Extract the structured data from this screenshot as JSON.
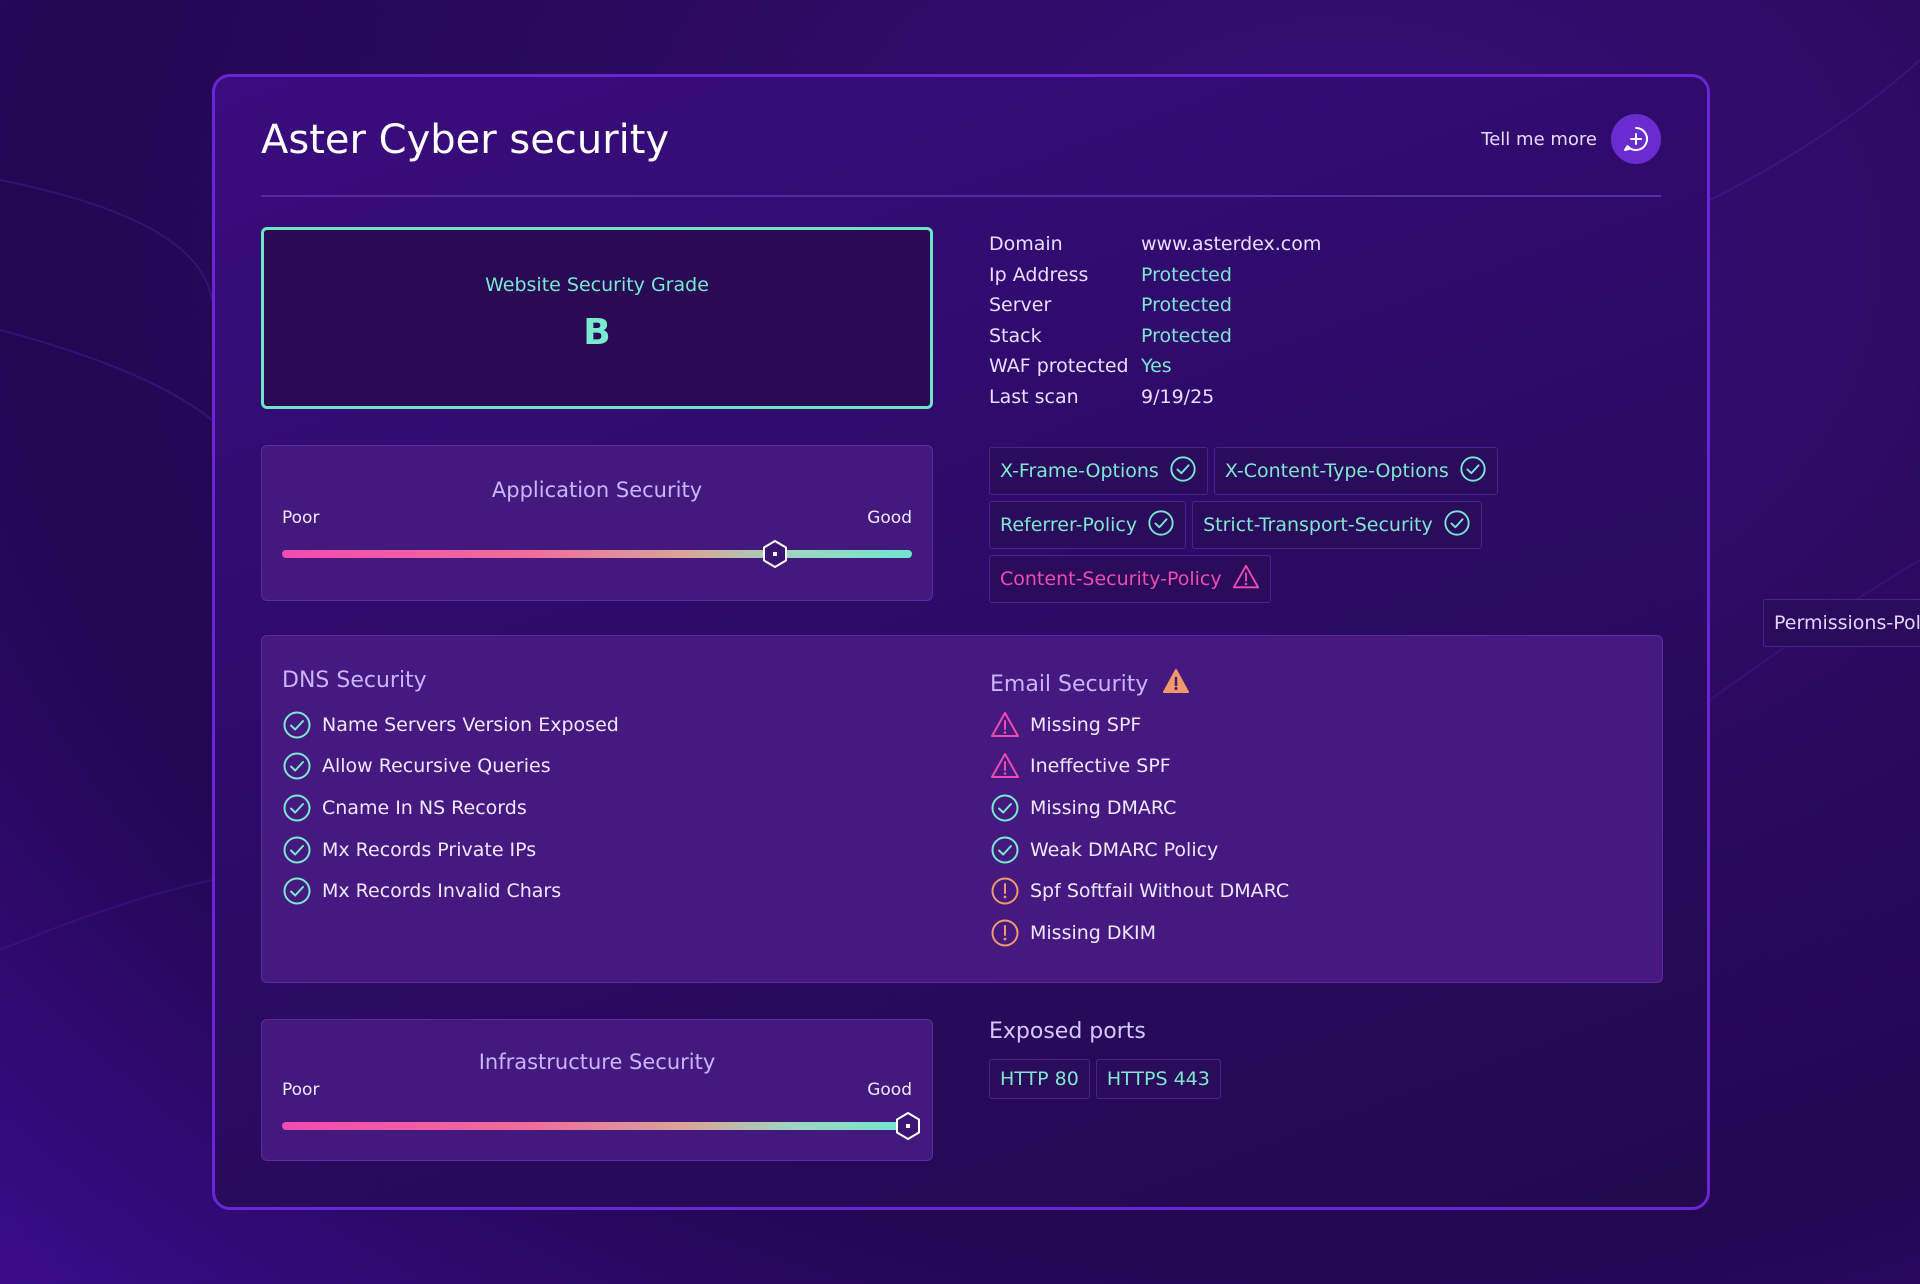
{
  "colors": {
    "accent_teal": "#79e9cf",
    "warning_pink": "#f04bb1",
    "warning_orange": "#f2996a",
    "card_border": "#6a26d6"
  },
  "header": {
    "title": "Aster Cyber security",
    "tell_more_label": "Tell me more",
    "tell_more_icon": "chat-plus-icon"
  },
  "grade": {
    "label": "Website Security Grade",
    "value": "B"
  },
  "info": [
    {
      "key": "Domain",
      "value": "www.asterdex.com"
    },
    {
      "key": "Ip Address",
      "value": "Protected"
    },
    {
      "key": "Server",
      "value": "Protected"
    },
    {
      "key": "Stack",
      "value": "Protected"
    },
    {
      "key": "WAF protected",
      "value": "Yes"
    },
    {
      "key": "Last scan",
      "value": "9/19/25"
    }
  ],
  "application_security": {
    "title": "Application Security",
    "low_label": "Poor",
    "high_label": "Good",
    "level": 0.78
  },
  "infrastructure_security": {
    "title": "Infrastructure Security",
    "low_label": "Poor",
    "high_label": "Good",
    "level": 0.99
  },
  "headers": [
    {
      "label": "X-Frame-Options",
      "status": "ok"
    },
    {
      "label": "X-Content-Type-Options",
      "status": "ok"
    },
    {
      "label": "Referrer-Policy",
      "status": "ok"
    },
    {
      "label": "Strict-Transport-Security",
      "status": "ok"
    },
    {
      "label": "Content-Security-Policy",
      "status": "warning"
    },
    {
      "label": "Permissions-Policy",
      "status": "info"
    }
  ],
  "dns": {
    "title": "DNS Security",
    "items": [
      {
        "label": "Name Servers Version Exposed",
        "status": "ok"
      },
      {
        "label": "Allow Recursive Queries",
        "status": "ok"
      },
      {
        "label": "Cname In NS Records",
        "status": "ok"
      },
      {
        "label": "Mx Records Private IPs",
        "status": "ok"
      },
      {
        "label": "Mx Records Invalid Chars",
        "status": "ok"
      }
    ]
  },
  "email": {
    "title": "Email Security",
    "title_icon": "warning-filled-icon",
    "items": [
      {
        "label": "Missing SPF",
        "status": "warning"
      },
      {
        "label": "Ineffective SPF",
        "status": "warning"
      },
      {
        "label": "Missing DMARC",
        "status": "ok"
      },
      {
        "label": "Weak DMARC Policy",
        "status": "ok"
      },
      {
        "label": "Spf Softfail Without DMARC",
        "status": "alert"
      },
      {
        "label": "Missing DKIM",
        "status": "alert"
      }
    ]
  },
  "ports": {
    "title": "Exposed ports",
    "items": [
      "HTTP 80",
      "HTTPS 443"
    ]
  }
}
